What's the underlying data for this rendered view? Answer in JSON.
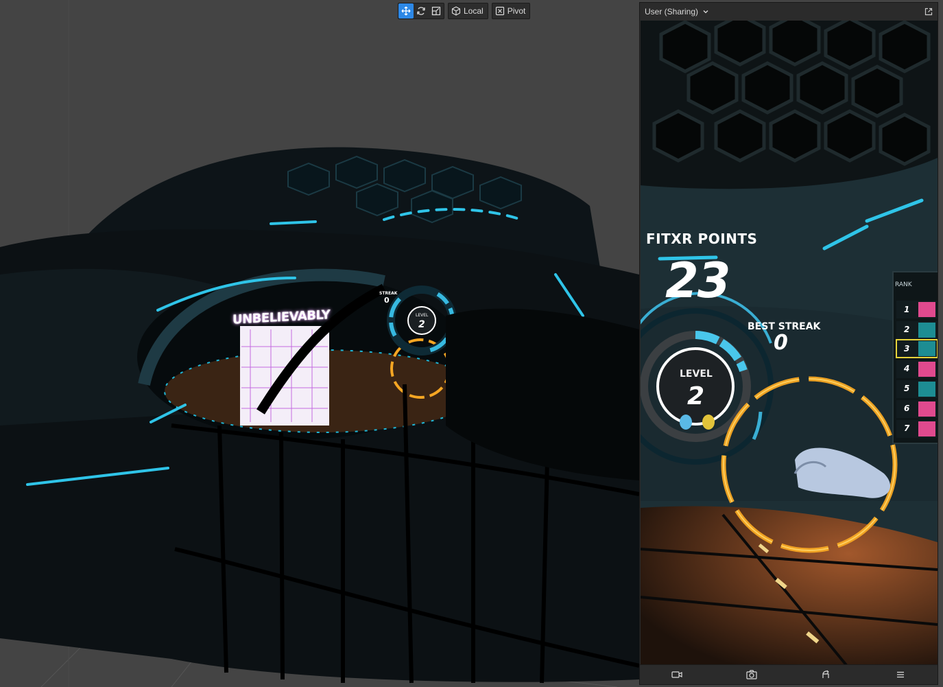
{
  "toolbar": {
    "move_icon": "move-arrows-icon",
    "rotate_icon": "rotate-icon",
    "scale_icon": "scale-icon",
    "space_label": "Local",
    "space_icon": "cube-icon",
    "pivot_label": "Pivot",
    "pivot_icon": "pivot-icon",
    "accent_color": "#2d88e6"
  },
  "scene": {
    "sign_text": "UNBELIEVABLY",
    "streak_label": "STREAK",
    "streak_value": "0",
    "level_label": "LEVEL",
    "level_value": "2"
  },
  "panel": {
    "title": "User (Sharing)",
    "dropdown_icon": "chevron-down-icon",
    "popout_icon": "popout-icon",
    "game": {
      "points_label": "FITXR POINTS",
      "points_value": "23",
      "best_streak_label": "BEST STREAK",
      "best_streak_value": "0",
      "level_label": "LEVEL",
      "level_value": "2",
      "rank_label": "RANK",
      "ranks": [
        "1",
        "2",
        "3",
        "4",
        "5",
        "6",
        "7"
      ],
      "highlighted_rank": "3",
      "ring_color": "#f5a623",
      "neon_color": "#2fc4e8"
    },
    "footer": {
      "record_icon": "video-camera-icon",
      "screenshot_icon": "camera-icon",
      "recenter_icon": "rotate-view-icon",
      "menu_icon": "hamburger-menu-icon"
    }
  }
}
